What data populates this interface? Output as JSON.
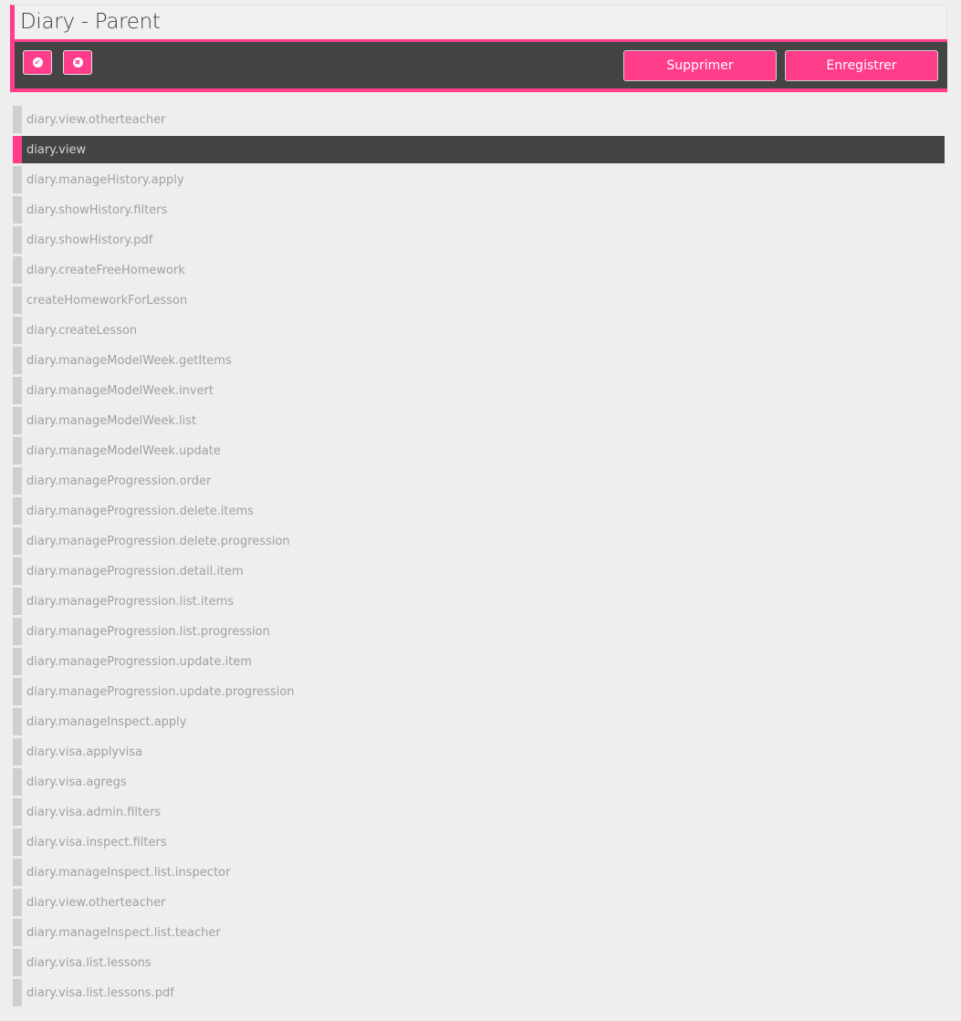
{
  "header": {
    "title": "Diary - Parent",
    "accent_color": "#ff3d8b",
    "toolbar_color": "#444444"
  },
  "toolbar": {
    "select_all_icon": "check-circle-icon",
    "deselect_all_icon": "x-circle-icon",
    "delete_label": "Supprimer",
    "save_label": "Enregistrer"
  },
  "rights": {
    "items": [
      {
        "label": "diary.view.otherteacher",
        "selected": false
      },
      {
        "label": "diary.view",
        "selected": true
      },
      {
        "label": "diary.manageHistory.apply",
        "selected": false
      },
      {
        "label": "diary.showHistory.filters",
        "selected": false
      },
      {
        "label": "diary.showHistory.pdf",
        "selected": false
      },
      {
        "label": "diary.createFreeHomework",
        "selected": false
      },
      {
        "label": "createHomeworkForLesson",
        "selected": false
      },
      {
        "label": "diary.createLesson",
        "selected": false
      },
      {
        "label": "diary.manageModelWeek.getItems",
        "selected": false
      },
      {
        "label": "diary.manageModelWeek.invert",
        "selected": false
      },
      {
        "label": "diary.manageModelWeek.list",
        "selected": false
      },
      {
        "label": "diary.manageModelWeek.update",
        "selected": false
      },
      {
        "label": "diary.manageProgression.order",
        "selected": false
      },
      {
        "label": "diary.manageProgression.delete.items",
        "selected": false
      },
      {
        "label": "diary.manageProgression.delete.progression",
        "selected": false
      },
      {
        "label": "diary.manageProgression.detail.item",
        "selected": false
      },
      {
        "label": "diary.manageProgression.list.items",
        "selected": false
      },
      {
        "label": "diary.manageProgression.list.progression",
        "selected": false
      },
      {
        "label": "diary.manageProgression.update.item",
        "selected": false
      },
      {
        "label": "diary.manageProgression.update.progression",
        "selected": false
      },
      {
        "label": "diary.manageInspect.apply",
        "selected": false
      },
      {
        "label": "diary.visa.applyvisa",
        "selected": false
      },
      {
        "label": "diary.visa.agregs",
        "selected": false
      },
      {
        "label": "diary.visa.admin.filters",
        "selected": false
      },
      {
        "label": "diary.visa.inspect.filters",
        "selected": false
      },
      {
        "label": "diary.manageInspect.list.inspector",
        "selected": false
      },
      {
        "label": "diary.view.otherteacher",
        "selected": false
      },
      {
        "label": "diary.manageInspect.list.teacher",
        "selected": false
      },
      {
        "label": "diary.visa.list.lessons",
        "selected": false
      },
      {
        "label": "diary.visa.list.lessons.pdf",
        "selected": false
      }
    ]
  }
}
